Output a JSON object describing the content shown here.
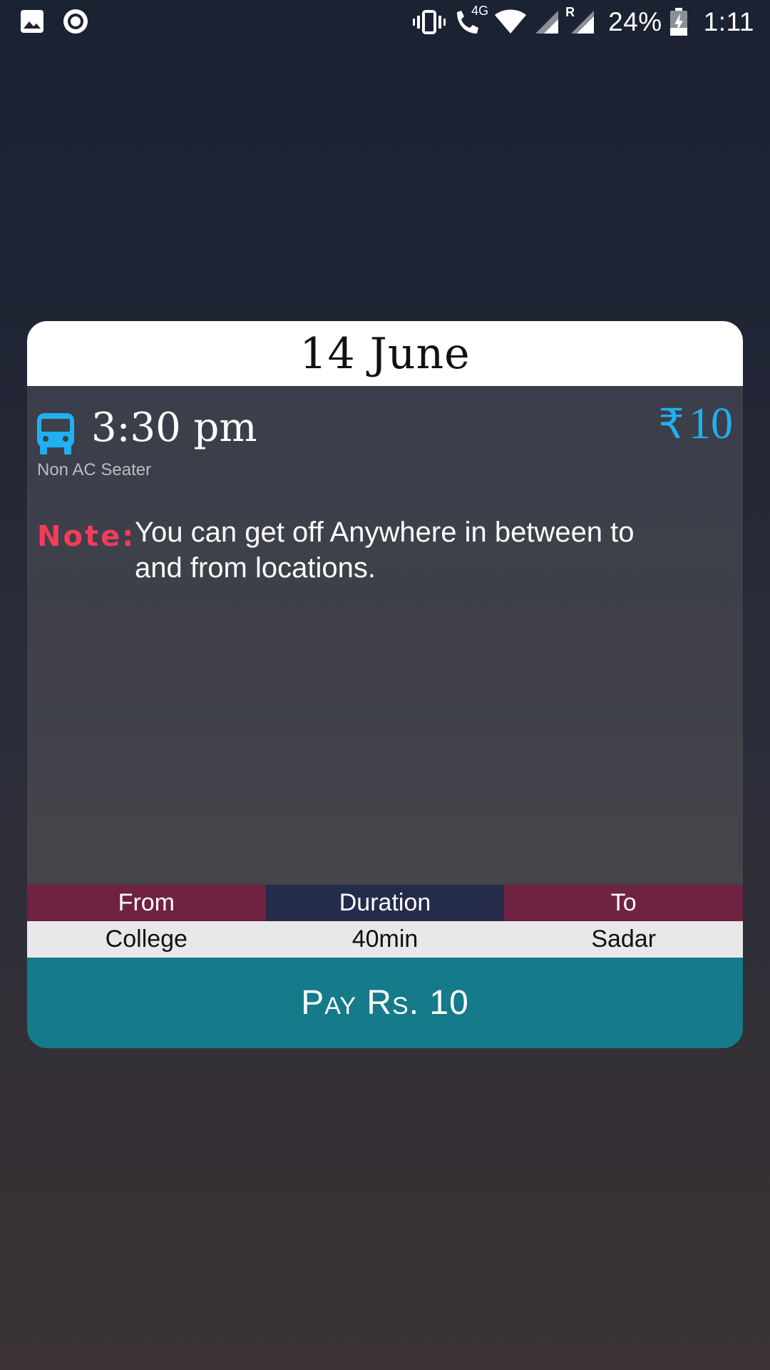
{
  "status_bar": {
    "battery_percent": "24%",
    "time": "1:11",
    "network_label": "4G",
    "roaming_label": "R",
    "left_icons": [
      "image-icon",
      "record-icon"
    ],
    "right_icons": [
      "vibrate-icon",
      "call-icon",
      "wifi-icon",
      "signal-icon",
      "signal-roaming-icon",
      "battery-charging-icon"
    ]
  },
  "ticket": {
    "date": "14 June",
    "departure_time": "3:30 pm",
    "bus_type": "Non AC Seater",
    "currency_symbol": "₹",
    "price": "10",
    "note_label": "Note:",
    "note_text": "You can get off Anywhere in between to and from locations.",
    "table": {
      "headers": [
        "From",
        "Duration",
        "To"
      ],
      "values": [
        "College",
        "40min",
        "Sadar"
      ]
    },
    "pay_button_label": "Pay Rs. 10"
  },
  "colors": {
    "accent_blue": "#1fb0f0",
    "note_red": "#f23d5a",
    "header_maroon": "#6f2242",
    "header_navy": "#252c4b",
    "pay_teal": "#157a89"
  }
}
